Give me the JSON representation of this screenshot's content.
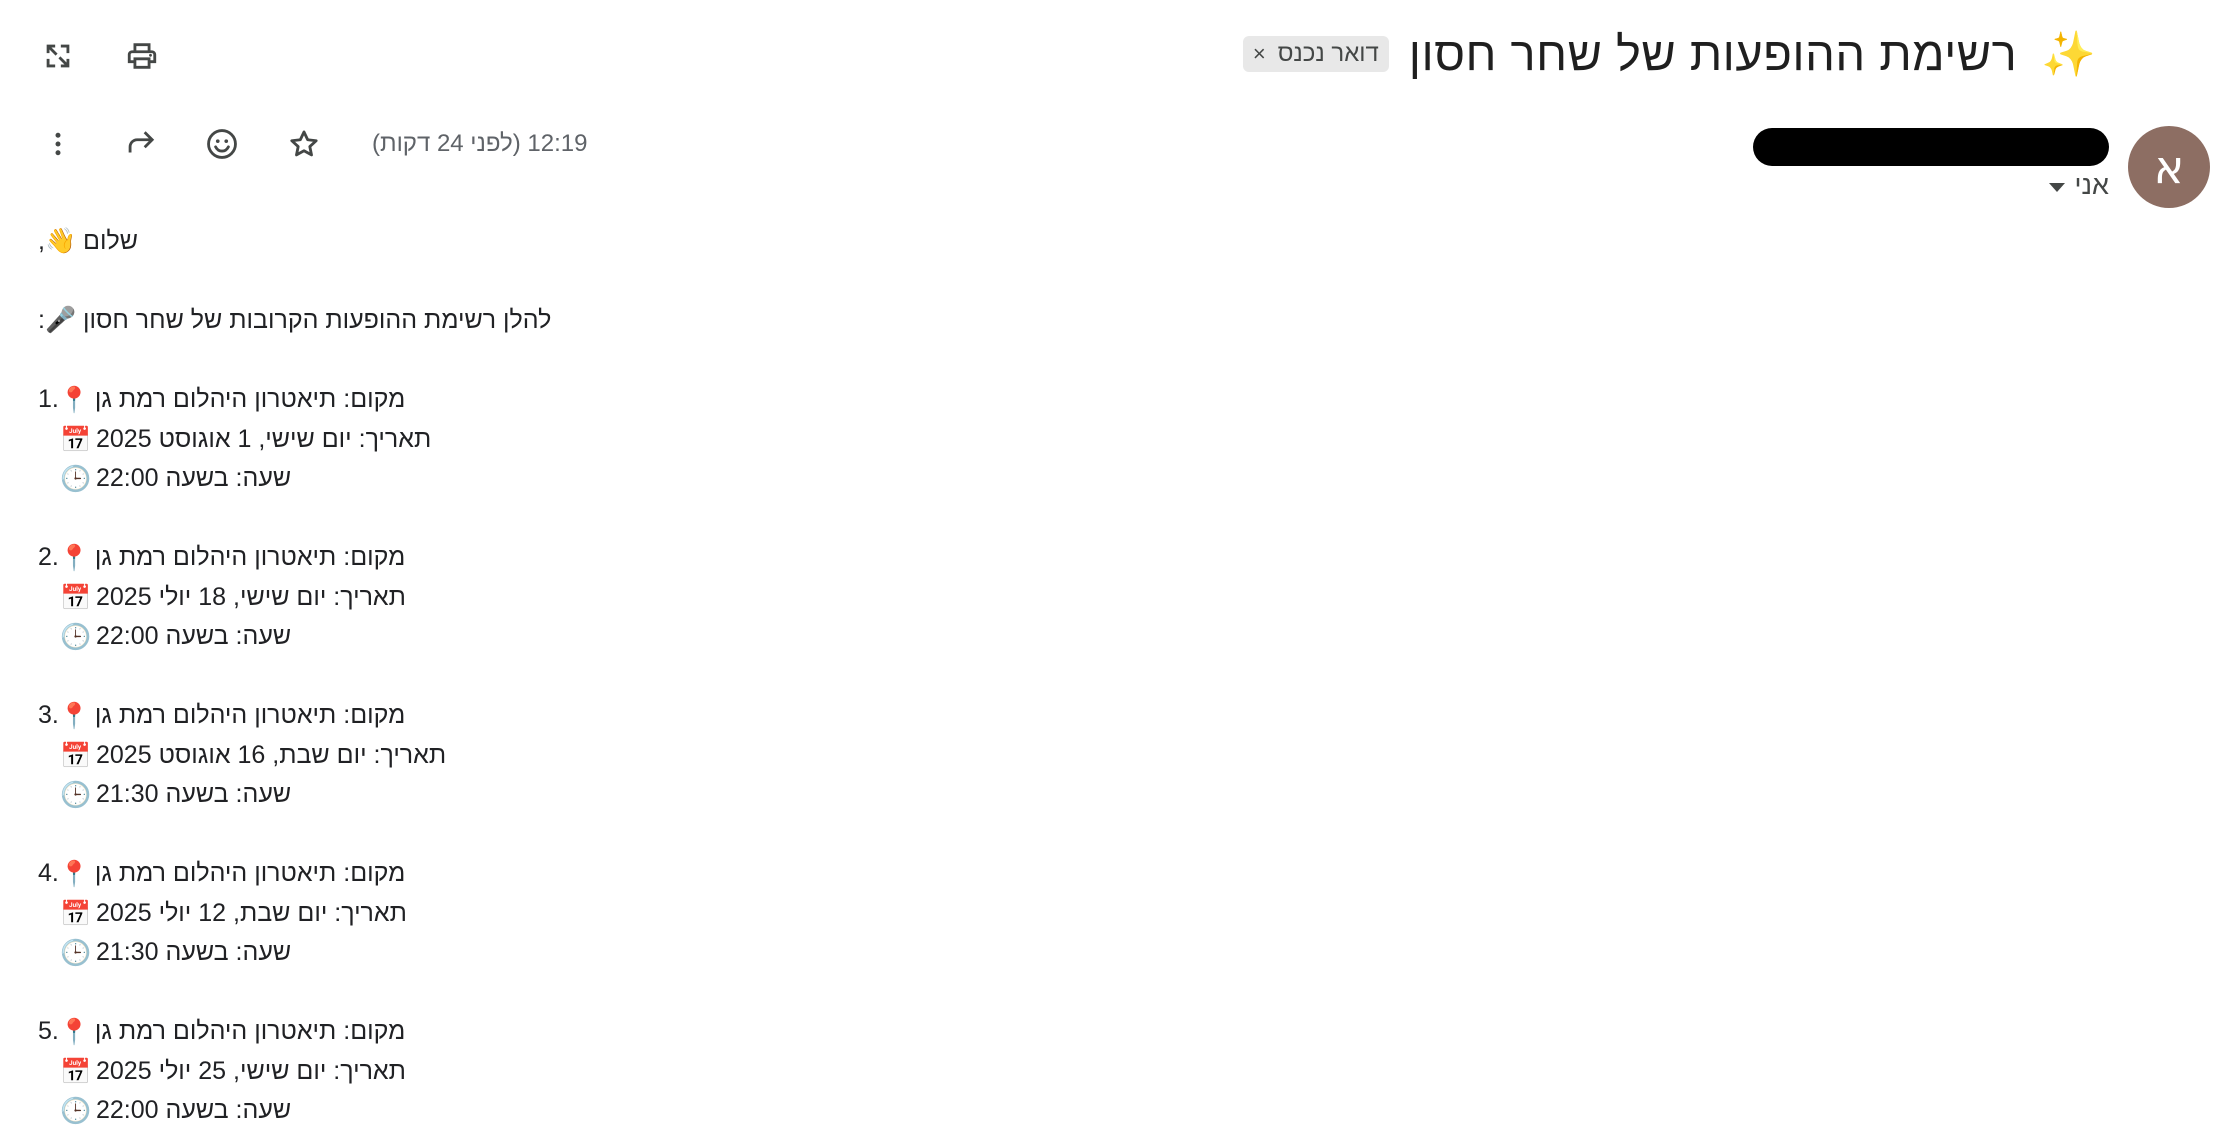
{
  "header": {
    "subject": "רשימת ההופעות של שחר חסון",
    "subject_emoji": "✨",
    "label": "דואר נכנס",
    "label_remove": "×"
  },
  "toolbar": {
    "icons": [
      "open-in-new-window-icon",
      "print-icon"
    ]
  },
  "meta": {
    "timestamp": "12:19 (לפני 24 דקות)",
    "icons": [
      "more-options-icon",
      "forward-icon",
      "emoji-reaction-icon",
      "star-icon"
    ]
  },
  "sender": {
    "avatar_letter": "א",
    "avatar_color": "#8d6e63",
    "recipient": "אני"
  },
  "body": {
    "greeting": "שלום 👋,",
    "intro": "להלן רשימת ההופעות הקרובות של שחר חסון 🎤:",
    "emoji": {
      "pin": "📍",
      "calendar": "📅",
      "clock": "🕒"
    },
    "shows": [
      {
        "num": "1.",
        "place": "מקום: תיאטרון היהלום רמת גן",
        "date": "תאריך: יום שישי, 1 אוגוסט 2025",
        "time": "שעה: בשעה 22:00"
      },
      {
        "num": "2.",
        "place": "מקום: תיאטרון היהלום רמת גן",
        "date": "תאריך: יום שישי, 18 יולי 2025",
        "time": "שעה: בשעה 22:00"
      },
      {
        "num": "3.",
        "place": "מקום: תיאטרון היהלום רמת גן",
        "date": "תאריך: יום שבת, 16 אוגוסט 2025",
        "time": "שעה: בשעה 21:30"
      },
      {
        "num": "4.",
        "place": "מקום: תיאטרון היהלום רמת גן",
        "date": "תאריך: יום שבת, 12 יולי 2025",
        "time": "שעה: בשעה 21:30"
      },
      {
        "num": "5.",
        "place": "מקום: תיאטרון היהלום רמת גן",
        "date": "תאריך: יום שישי, 25 יולי 2025",
        "time": "שעה: בשעה 22:00"
      }
    ]
  }
}
